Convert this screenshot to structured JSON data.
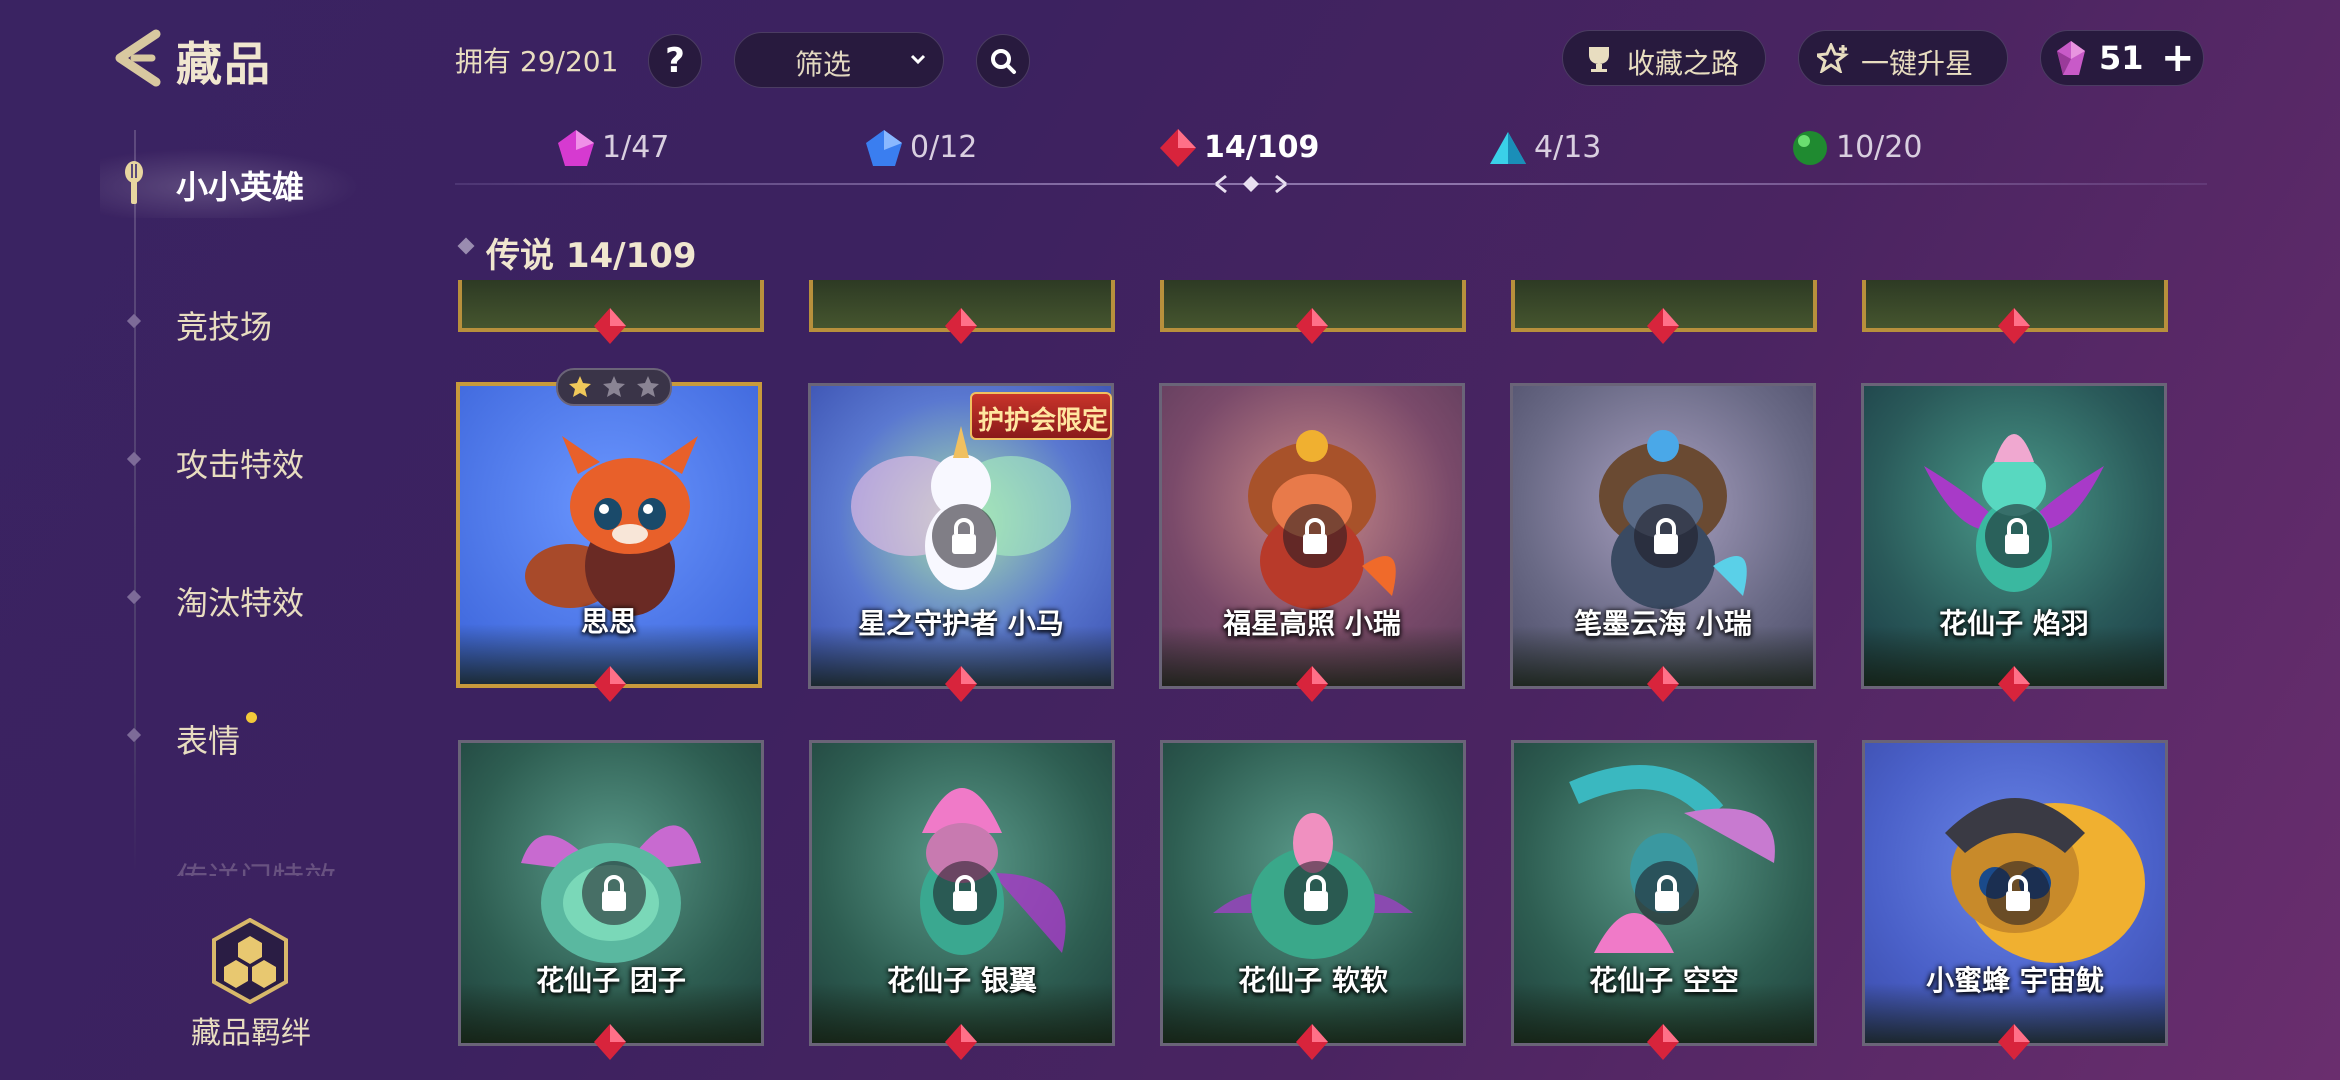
{
  "header": {
    "title": "藏品",
    "owned_label": "拥有 29/201",
    "help_label": "?",
    "filter_label": "筛选",
    "road_label": "收藏之路",
    "star_label": "一键升星",
    "gem_count": "51",
    "add_label": "+"
  },
  "sidebar": {
    "items": [
      {
        "label": "小小英雄"
      },
      {
        "label": "竞技场"
      },
      {
        "label": "攻击特效"
      },
      {
        "label": "淘汰特效"
      },
      {
        "label": "表情"
      },
      {
        "label": "传送门特效"
      }
    ],
    "bond_label": "藏品羁绊"
  },
  "rarity_tabs": [
    {
      "count": "1/47",
      "color": "#d63ad0"
    },
    {
      "count": "0/12",
      "color": "#3a7ef0"
    },
    {
      "count": "14/109",
      "color": "#d8243c"
    },
    {
      "count": "4/13",
      "color": "#3ad0e8"
    },
    {
      "count": "10/20",
      "color": "#27a83a"
    }
  ],
  "section": {
    "title": "传说 14/109"
  },
  "cards_row1": [
    {
      "name": "思思",
      "locked": false,
      "bg": "#4a78e8"
    },
    {
      "name": "星之守护者 小马",
      "locked": true,
      "bg": "#5a6ed0",
      "badge": "护护会限定"
    },
    {
      "name": "福星高照 小瑞",
      "locked": true,
      "bg": "#8a5a6a"
    },
    {
      "name": "笔墨云海 小瑞",
      "locked": true,
      "bg": "#6a6a86"
    },
    {
      "name": "花仙子 焰羽",
      "locked": true,
      "bg": "#2e6a62"
    }
  ],
  "cards_row2": [
    {
      "name": "花仙子 团子",
      "locked": true,
      "bg": "#3a6e5a"
    },
    {
      "name": "花仙子 银翼",
      "locked": true,
      "bg": "#3a6e62"
    },
    {
      "name": "花仙子 软软",
      "locked": true,
      "bg": "#3e7266"
    },
    {
      "name": "花仙子 空空",
      "locked": true,
      "bg": "#3a6a64"
    },
    {
      "name": "小蜜蜂 宇宙鱿",
      "locked": true,
      "bg": "#4a60c8"
    }
  ],
  "star_rating": {
    "filled": 1,
    "total": 3
  }
}
